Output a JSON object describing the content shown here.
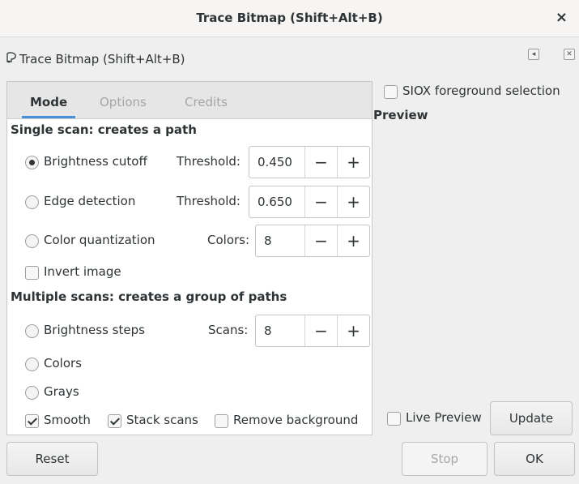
{
  "window": {
    "title": "Trace Bitmap (Shift+Alt+B)",
    "close_glyph": "×"
  },
  "dock": {
    "icon": "trace-bitmap-icon",
    "title": "Trace Bitmap (Shift+Alt+B)",
    "iconify_glyph": "◂",
    "close_glyph": "✕"
  },
  "tabs": [
    {
      "label": "Mode",
      "active": true
    },
    {
      "label": "Options",
      "active": false
    },
    {
      "label": "Credits",
      "active": false
    }
  ],
  "single_scan": {
    "section_title": "Single scan: creates a path",
    "brightness": {
      "label": "Brightness cutoff",
      "checked": true,
      "param_label": "Threshold:",
      "value": "0.450"
    },
    "edge": {
      "label": "Edge detection",
      "checked": false,
      "param_label": "Threshold:",
      "value": "0.650"
    },
    "color_quant": {
      "label": "Color quantization",
      "checked": false,
      "param_label": "Colors:",
      "value": "8"
    },
    "invert": {
      "label": "Invert image",
      "checked": false
    }
  },
  "multiple_scans": {
    "section_title": "Multiple scans: creates a group of paths",
    "brightness_steps": {
      "label": "Brightness steps",
      "checked": false,
      "param_label": "Scans:",
      "value": "8"
    },
    "colors": {
      "label": "Colors",
      "checked": false
    },
    "grays": {
      "label": "Grays",
      "checked": false
    },
    "smooth": {
      "label": "Smooth",
      "checked": true
    },
    "stack_scans": {
      "label": "Stack scans",
      "checked": true
    },
    "remove_background": {
      "label": "Remove background",
      "checked": false
    }
  },
  "spin_buttons": {
    "minus": "−",
    "plus": "+"
  },
  "right_panel": {
    "siox": {
      "label": "SIOX foreground selection",
      "checked": false
    },
    "preview_title": "Preview",
    "live_preview": {
      "label": "Live Preview",
      "checked": false
    },
    "update_label": "Update"
  },
  "footer": {
    "reset_label": "Reset",
    "stop_label": "Stop",
    "ok_label": "OK"
  },
  "colors": {
    "accent": "#4a90d9",
    "window_bg": "#efefef",
    "panel_bg": "#ffffff",
    "disabled_text": "#a6a8a8"
  }
}
